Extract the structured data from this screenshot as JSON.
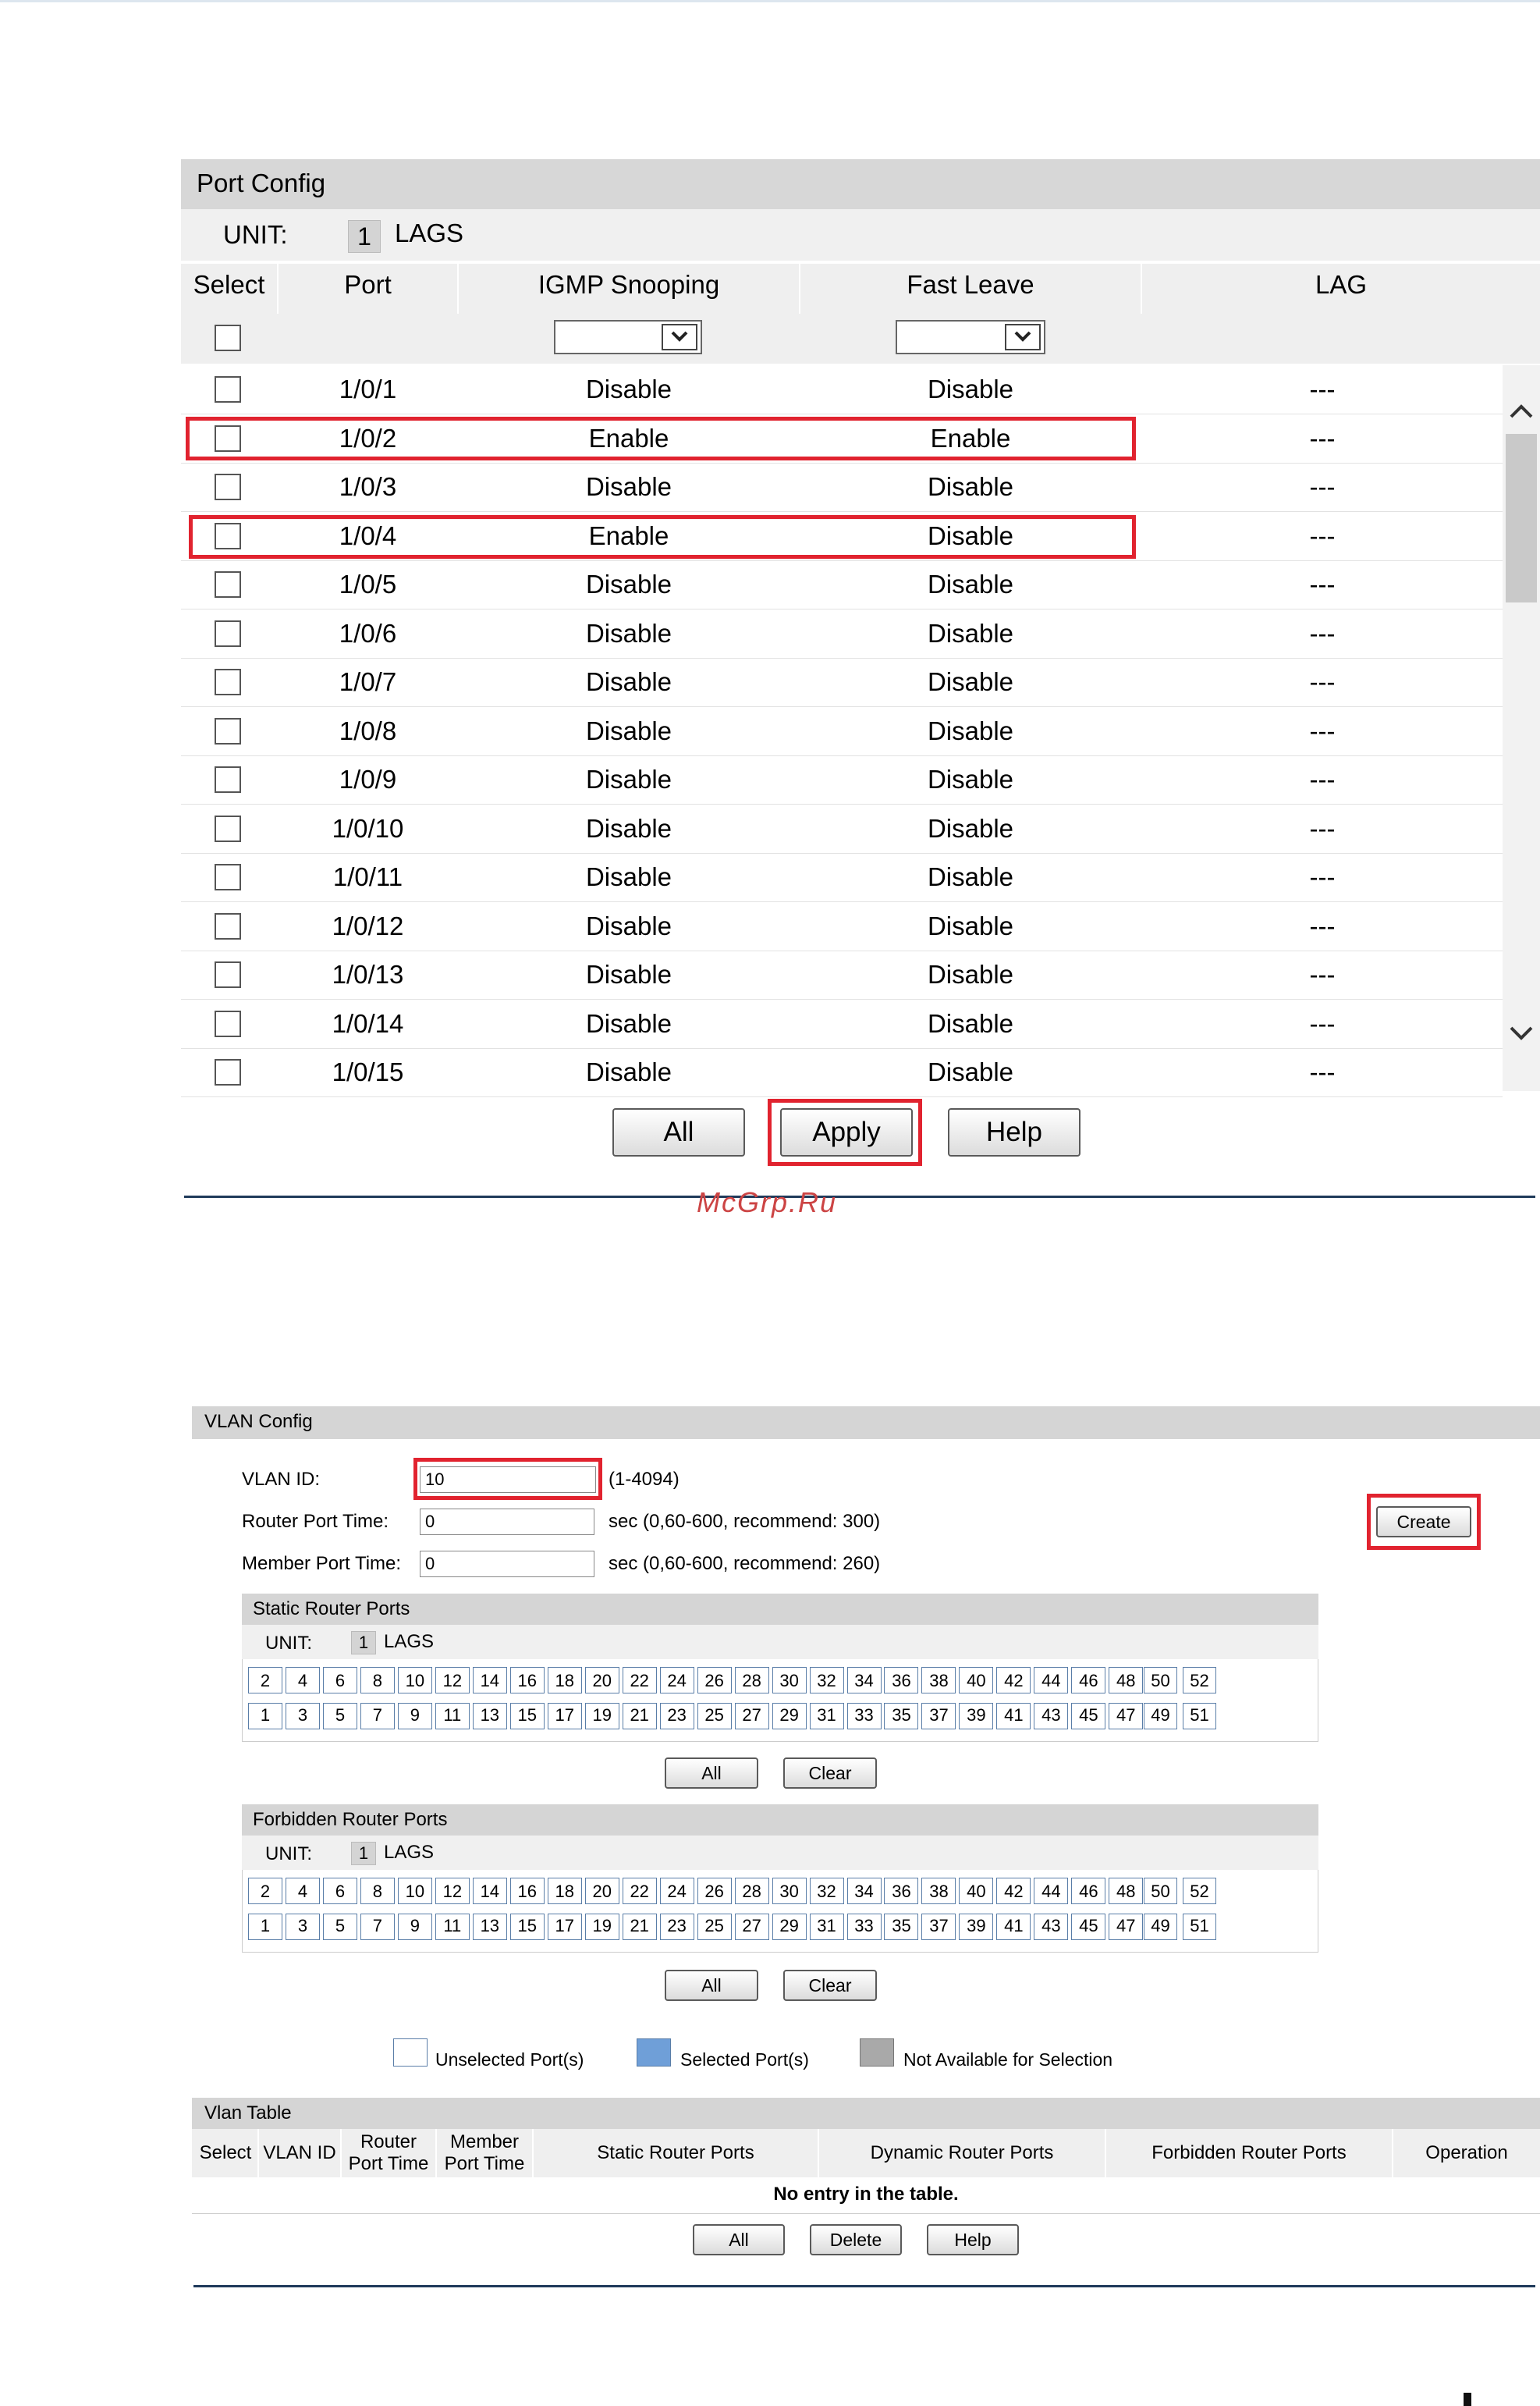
{
  "port_config": {
    "title": "Port Config",
    "unit_label": "UNIT:",
    "unit_value": "1",
    "lags_label": "LAGS",
    "columns": [
      "Select",
      "Port",
      "IGMP Snooping",
      "Fast Leave",
      "LAG"
    ],
    "rows": [
      {
        "port": "1/0/1",
        "igmp": "Disable",
        "fast_leave": "Disable",
        "lag": "---"
      },
      {
        "port": "1/0/2",
        "igmp": "Enable",
        "fast_leave": "Enable",
        "lag": "---"
      },
      {
        "port": "1/0/3",
        "igmp": "Disable",
        "fast_leave": "Disable",
        "lag": "---"
      },
      {
        "port": "1/0/4",
        "igmp": "Enable",
        "fast_leave": "Disable",
        "lag": "---"
      },
      {
        "port": "1/0/5",
        "igmp": "Disable",
        "fast_leave": "Disable",
        "lag": "---"
      },
      {
        "port": "1/0/6",
        "igmp": "Disable",
        "fast_leave": "Disable",
        "lag": "---"
      },
      {
        "port": "1/0/7",
        "igmp": "Disable",
        "fast_leave": "Disable",
        "lag": "---"
      },
      {
        "port": "1/0/8",
        "igmp": "Disable",
        "fast_leave": "Disable",
        "lag": "---"
      },
      {
        "port": "1/0/9",
        "igmp": "Disable",
        "fast_leave": "Disable",
        "lag": "---"
      },
      {
        "port": "1/0/10",
        "igmp": "Disable",
        "fast_leave": "Disable",
        "lag": "---"
      },
      {
        "port": "1/0/11",
        "igmp": "Disable",
        "fast_leave": "Disable",
        "lag": "---"
      },
      {
        "port": "1/0/12",
        "igmp": "Disable",
        "fast_leave": "Disable",
        "lag": "---"
      },
      {
        "port": "1/0/13",
        "igmp": "Disable",
        "fast_leave": "Disable",
        "lag": "---"
      },
      {
        "port": "1/0/14",
        "igmp": "Disable",
        "fast_leave": "Disable",
        "lag": "---"
      },
      {
        "port": "1/0/15",
        "igmp": "Disable",
        "fast_leave": "Disable",
        "lag": "---"
      }
    ],
    "buttons": {
      "all": "All",
      "apply": "Apply",
      "help": "Help"
    }
  },
  "watermark": "McGrp.Ru",
  "vlan_config": {
    "title": "VLAN Config",
    "vlan_id_label": "VLAN ID:",
    "vlan_id_value": "10",
    "vlan_id_hint": "(1-4094)",
    "router_port_time_label": "Router Port Time:",
    "router_port_time_value": "0",
    "router_port_time_hint": "sec (0,60-600, recommend: 300)",
    "member_port_time_label": "Member Port Time:",
    "member_port_time_value": "0",
    "member_port_time_hint": "sec (0,60-600, recommend: 260)",
    "create_button": "Create",
    "static_router_ports": {
      "title": "Static Router Ports",
      "unit_label": "UNIT:",
      "unit_value": "1",
      "lags_label": "LAGS",
      "all_button": "All",
      "clear_button": "Clear"
    },
    "forbidden_router_ports": {
      "title": "Forbidden Router Ports",
      "unit_label": "UNIT:",
      "unit_value": "1",
      "lags_label": "LAGS",
      "all_button": "All",
      "clear_button": "Clear"
    },
    "ports_top": [
      "2",
      "4",
      "6",
      "8",
      "10",
      "12",
      "14",
      "16",
      "18",
      "20",
      "22",
      "24",
      "26",
      "28",
      "30",
      "32",
      "34",
      "36",
      "38",
      "40",
      "42",
      "44",
      "46",
      "48"
    ],
    "ports_bottom": [
      "1",
      "3",
      "5",
      "7",
      "9",
      "11",
      "13",
      "15",
      "17",
      "19",
      "21",
      "23",
      "25",
      "27",
      "29",
      "31",
      "33",
      "35",
      "37",
      "39",
      "41",
      "43",
      "45",
      "47"
    ],
    "sfp_top": [
      "50",
      "52"
    ],
    "sfp_bottom": [
      "49",
      "51"
    ],
    "legend": {
      "unselected": "Unselected Port(s)",
      "selected": "Selected Port(s)",
      "not_available": "Not Available for Selection"
    }
  },
  "vlan_table": {
    "title": "Vlan Table",
    "columns": {
      "select": "Select",
      "vlan_id": "VLAN ID",
      "router_port_time_1": "Router",
      "router_port_time_2": "Port Time",
      "member_port_time_1": "Member",
      "member_port_time_2": "Port Time",
      "static_router_ports": "Static Router Ports",
      "dynamic_router_ports": "Dynamic Router Ports",
      "forbidden_router_ports": "Forbidden Router Ports",
      "operation": "Operation"
    },
    "empty_message": "No entry in the table.",
    "buttons": {
      "all": "All",
      "delete": "Delete",
      "help": "Help"
    }
  },
  "colors": {
    "highlight_red": "#e1232f",
    "header_gray": "#d7d7d7",
    "port_border": "#5a7ea8",
    "selected_port": "#6f9fd8",
    "unavailable_port": "#a9a9a9"
  }
}
